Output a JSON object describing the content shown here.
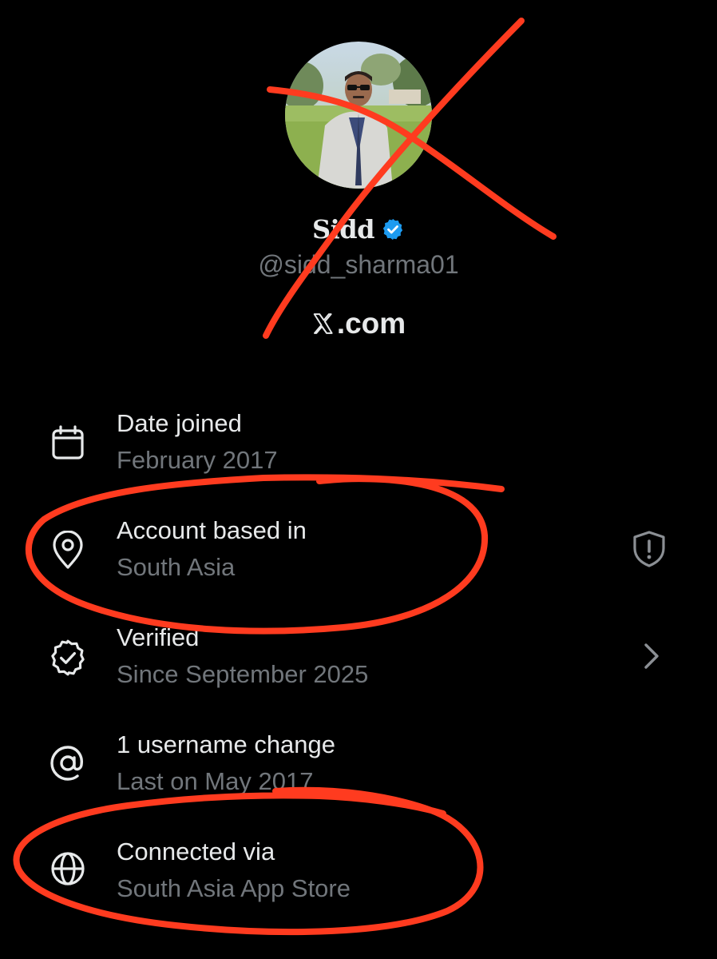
{
  "profile": {
    "display_name": "Sidd",
    "handle": "@sidd_sharma01",
    "site": ".com",
    "verified": true
  },
  "rows": [
    {
      "title": "Date joined",
      "subtitle": "February 2017",
      "icon": "calendar-icon"
    },
    {
      "title": "Account based in",
      "subtitle": "South Asia",
      "icon": "location-pin-icon",
      "trailing_icon": "shield-alert-icon"
    },
    {
      "title": "Verified",
      "subtitle": "Since September 2025",
      "icon": "verified-badge-icon",
      "trailing_icon": "chevron-right-icon"
    },
    {
      "title": "1 username change",
      "subtitle": "Last on May 2017",
      "icon": "at-sign-icon"
    },
    {
      "title": "Connected via",
      "subtitle": "South Asia App Store",
      "icon": "globe-icon"
    }
  ],
  "colors": {
    "background": "#000000",
    "primary_text": "#e7e9ea",
    "secondary_text": "#71767b",
    "verified_blue": "#1d9bf0",
    "annotation_red": "#ff3b1f"
  }
}
